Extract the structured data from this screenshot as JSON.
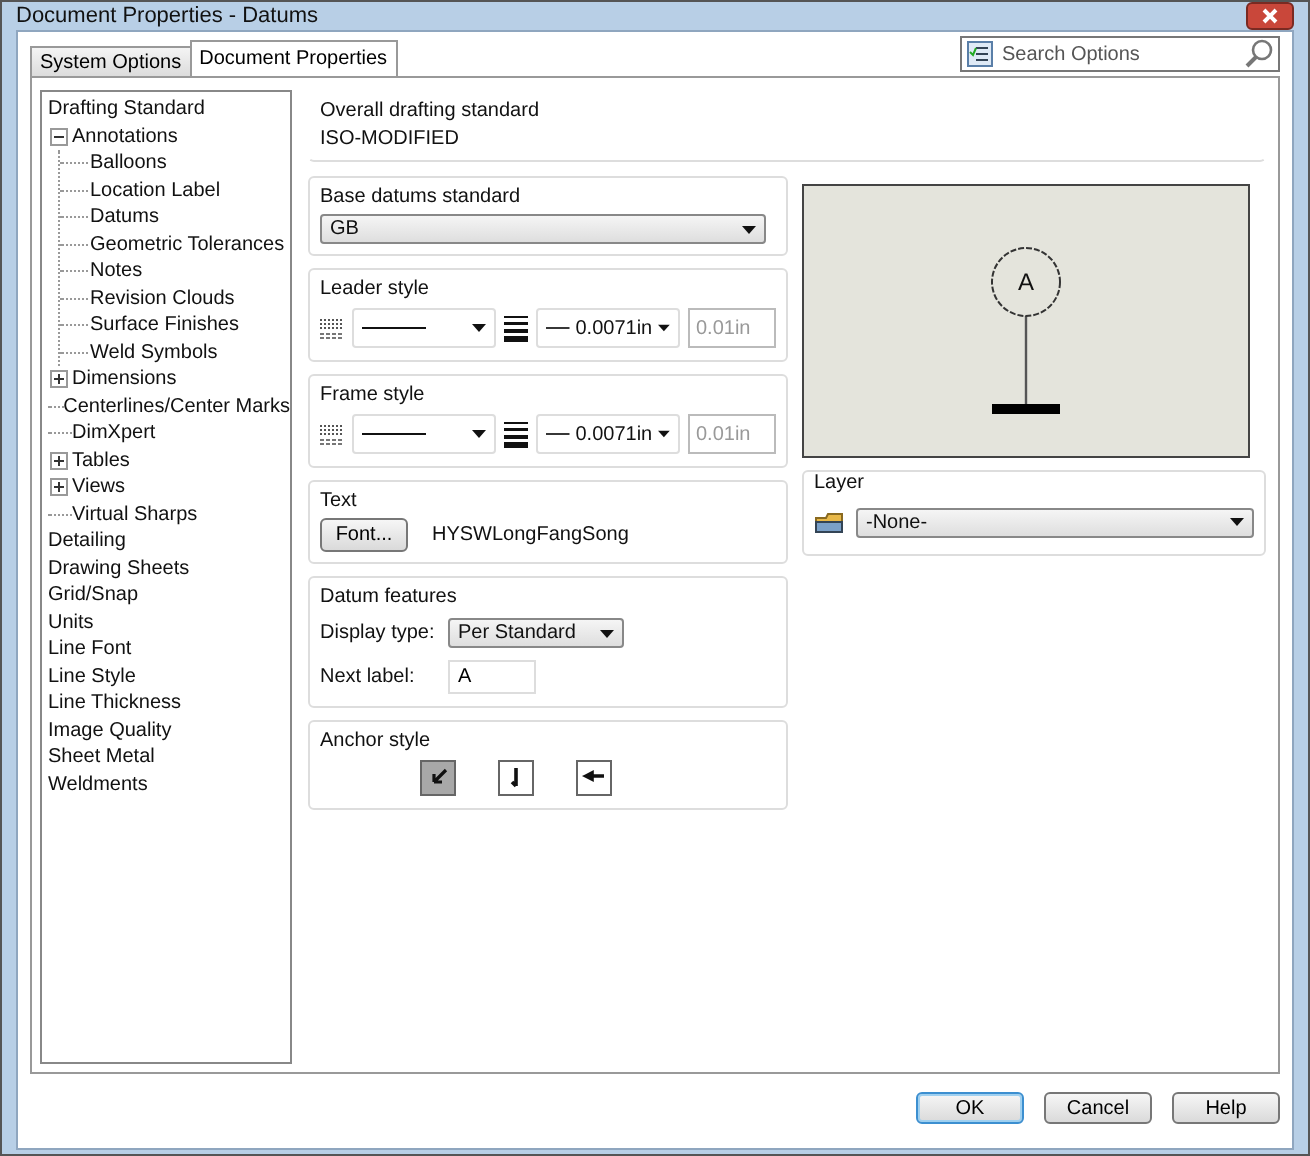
{
  "window": {
    "title": "Document Properties - Datums"
  },
  "tabs": [
    {
      "label": "System Options",
      "selected": false
    },
    {
      "label": "Document Properties",
      "selected": true
    }
  ],
  "search": {
    "placeholder": "Search Options"
  },
  "tree": [
    {
      "label": "Drafting Standard"
    },
    {
      "label": "Annotations",
      "expanded": true,
      "children": [
        {
          "label": "Balloons"
        },
        {
          "label": "Location Label"
        },
        {
          "label": "Datums"
        },
        {
          "label": "Geometric Tolerances"
        },
        {
          "label": "Notes"
        },
        {
          "label": "Revision Clouds"
        },
        {
          "label": "Surface Finishes"
        },
        {
          "label": "Weld Symbols"
        }
      ]
    },
    {
      "label": "Dimensions",
      "expanded": false
    },
    {
      "label": "Centerlines/Center Marks"
    },
    {
      "label": "DimXpert"
    },
    {
      "label": "Tables",
      "expanded": false
    },
    {
      "label": "Views",
      "expanded": false
    },
    {
      "label": "Virtual Sharps"
    },
    {
      "label": "Detailing"
    },
    {
      "label": "Drawing Sheets"
    },
    {
      "label": "Grid/Snap"
    },
    {
      "label": "Units"
    },
    {
      "label": "Line Font"
    },
    {
      "label": "Line Style"
    },
    {
      "label": "Line Thickness"
    },
    {
      "label": "Image Quality"
    },
    {
      "label": "Sheet Metal"
    },
    {
      "label": "Weldments"
    }
  ],
  "overall_standard": {
    "title": "Overall drafting standard",
    "value": "ISO-MODIFIED"
  },
  "base_datums": {
    "title": "Base datums standard",
    "value": "GB"
  },
  "line_groups": [
    {
      "title": "Leader style",
      "thickness": "0.0071in",
      "custom": {
        "value": "0.01in",
        "disabled": true
      }
    },
    {
      "title": "Frame style",
      "thickness": "0.0071in",
      "custom": {
        "value": "0.01in",
        "disabled": true
      }
    }
  ],
  "text_group": {
    "title": "Text",
    "button": "Font...",
    "font": "HYSWLongFangSong"
  },
  "datum_features": {
    "title": "Datum features",
    "display_label": "Display type:",
    "display_value": "Per Standard",
    "next_label": "Next label:",
    "next_value": "A"
  },
  "anchor_style": {
    "title": "Anchor style",
    "options": [
      {
        "kind": "filled",
        "selected": true
      },
      {
        "kind": "open",
        "selected": false
      },
      {
        "kind": "side",
        "selected": false
      }
    ]
  },
  "preview": {
    "label": "A"
  },
  "layer": {
    "title": "Layer",
    "value": "-None-"
  },
  "buttons": [
    {
      "label": "OK",
      "default": true
    },
    {
      "label": "Cancel",
      "default": false
    },
    {
      "label": "Help",
      "default": false
    }
  ]
}
